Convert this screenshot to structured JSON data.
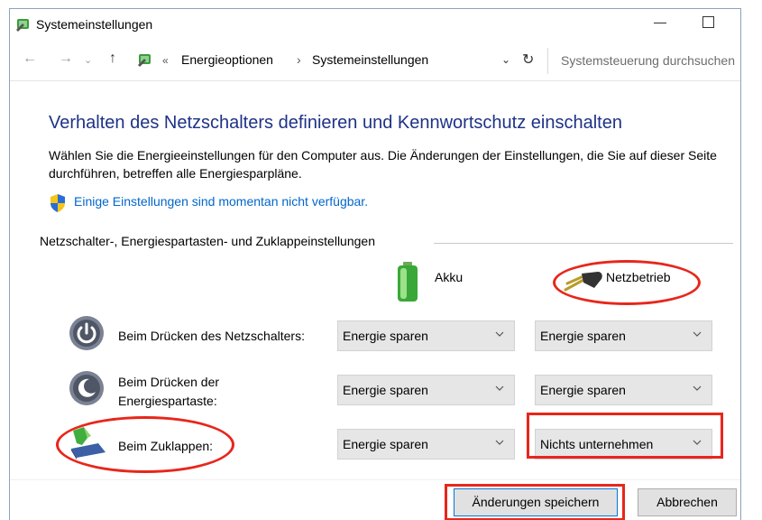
{
  "window": {
    "title": "Systemeinstellungen"
  },
  "address": {
    "collapsed_marker": "«",
    "crumbs": [
      "Energieoptionen",
      "Systemeinstellungen"
    ],
    "separator": "›",
    "search_placeholder": "Systemsteuerung durchsuchen"
  },
  "content": {
    "heading": "Verhalten des Netzschalters definieren und Kennwortschutz einschalten",
    "description": "Wählen Sie die Energieeinstellungen für den Computer aus. Die Änderungen der Einstellungen, die Sie auf dieser Seite durchführen, betreffen alle Energiesparpläne.",
    "unavailable_link": "Einige Einstellungen sind momentan nicht verfügbar.",
    "group_title": "Netzschalter-, Energiespartasten- und Zuklappeinstellungen",
    "columns": {
      "battery": "Akku",
      "plugged_in": "Netzbetrieb"
    },
    "rows": [
      {
        "label": "Beim Drücken des Netzschalters:",
        "battery": "Energie sparen",
        "plugged_in": "Energie sparen"
      },
      {
        "label_line1": "Beim Drücken der",
        "label_line2": "Energiespartaste:",
        "battery": "Energie sparen",
        "plugged_in": "Energie sparen"
      },
      {
        "label": "Beim Zuklappen:",
        "battery": "Energie sparen",
        "plugged_in": "Nichts unternehmen"
      }
    ]
  },
  "buttons": {
    "save": "Änderungen speichern",
    "cancel": "Abbrechen"
  },
  "colors": {
    "heading": "#1e3287",
    "link": "#0066cc",
    "highlight": "#e8261b",
    "select_bg": "#e6e6e6"
  }
}
